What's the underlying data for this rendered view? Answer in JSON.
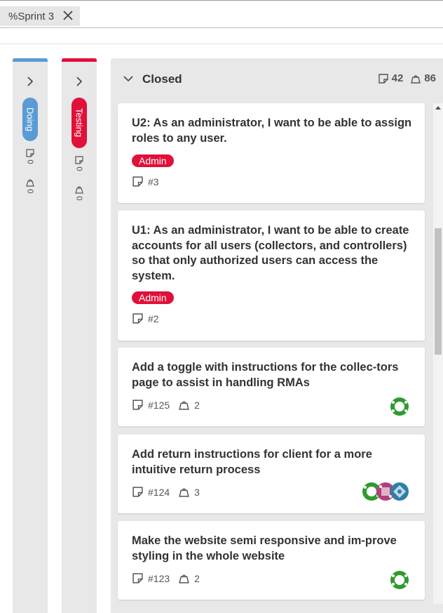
{
  "filter": {
    "label": "%Sprint 3"
  },
  "colors": {
    "doing": "#5b9bd5",
    "testing": "#e0103a",
    "tag": "#e0103a"
  },
  "lanes": [
    {
      "name": "Doing",
      "cards": "0",
      "estimate": "0"
    },
    {
      "name": "Testing",
      "cards": "0",
      "estimate": "0"
    }
  ],
  "closed": {
    "title": "Closed",
    "card_count": "42",
    "estimate_total": "86",
    "cards": [
      {
        "title": "U2: As an administrator, I want to be able to assign roles to any user.",
        "tag": "Admin",
        "number": "#3"
      },
      {
        "title": "U1: As an administrator, I want to be able to create accounts for all users (collectors, and controllers) so that only authorized users can access the system.",
        "tag": "Admin",
        "number": "#2"
      },
      {
        "title": "Add a toggle with instructions for the collec-tors page to assist in handling RMAs",
        "number": "#125",
        "estimate": "2"
      },
      {
        "title": "Add return instructions for client for a more intuitive return process",
        "number": "#124",
        "estimate": "3"
      },
      {
        "title": "Make the website semi responsive and im-prove styling in the whole website",
        "number": "#123",
        "estimate": "2"
      }
    ]
  }
}
